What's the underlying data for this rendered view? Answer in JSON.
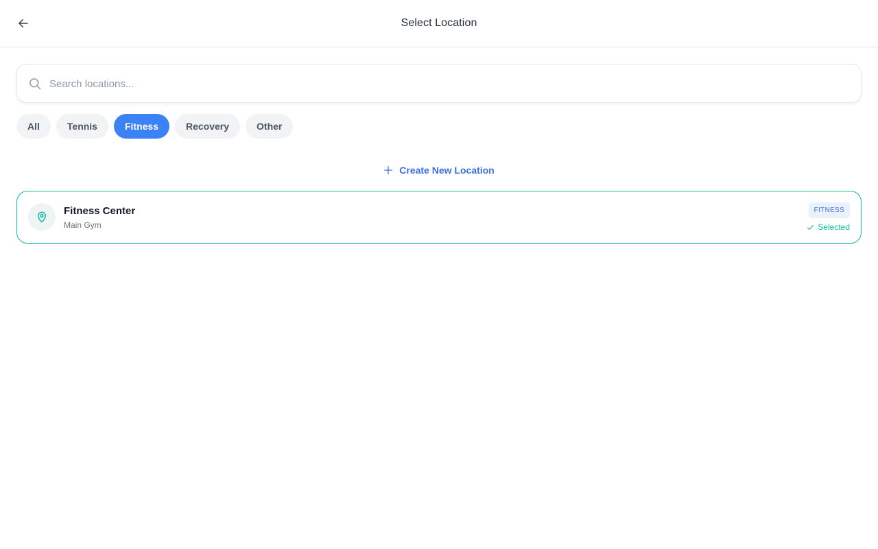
{
  "header": {
    "title": "Select Location",
    "back_icon": "arrow-left-icon"
  },
  "search": {
    "placeholder": "Search locations...",
    "value": "",
    "icon": "search-icon"
  },
  "filters": [
    {
      "label": "All",
      "active": false
    },
    {
      "label": "Tennis",
      "active": false
    },
    {
      "label": "Fitness",
      "active": true
    },
    {
      "label": "Recovery",
      "active": false
    },
    {
      "label": "Other",
      "active": false
    }
  ],
  "create": {
    "label": "Create New Location",
    "icon": "plus-icon"
  },
  "locations": [
    {
      "name": "Fitness Center",
      "subtitle": "Main Gym",
      "tag": "FITNESS",
      "status": "Selected",
      "icon": "map-pin-icon",
      "status_icon": "check-icon"
    }
  ],
  "colors": {
    "accent": "#3b82f6",
    "selected": "#14b8a6",
    "link": "#3b6fe0"
  }
}
